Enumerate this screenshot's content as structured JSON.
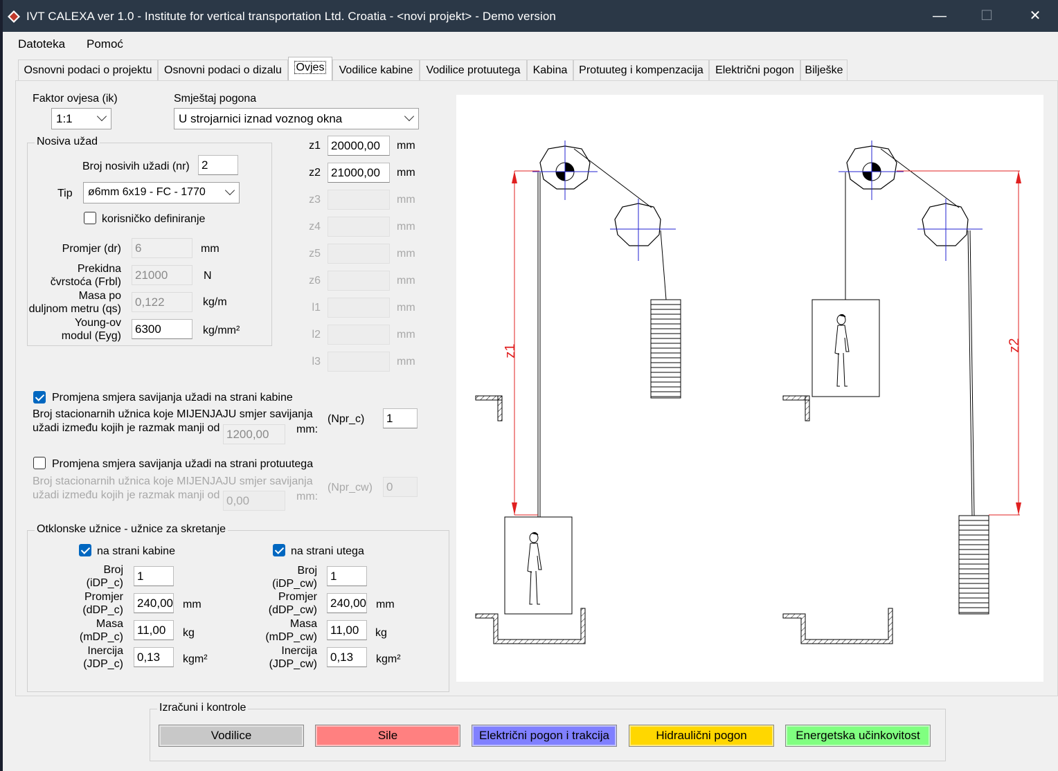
{
  "window": {
    "title": "IVT CALEXA ver 1.0 - Institute for vertical transportation Ltd. Croatia - <novi projekt> - Demo version",
    "minimize": "—",
    "maximize": "☐",
    "close": "✕"
  },
  "menu": {
    "items": [
      "Datoteka",
      "Pomoć"
    ]
  },
  "tabs": [
    "Osnovni podaci o projektu",
    "Osnovni podaci o dizalu",
    "Ovjes",
    "Vodilice kabine",
    "Vodilice protuutega",
    "Kabina",
    "Protuuteg i kompenzacija",
    "Električni pogon",
    "Bilješke"
  ],
  "active_tab": "Ovjes",
  "form": {
    "faktor_label": "Faktor ovjesa (ik)",
    "faktor_value": "1:1",
    "smjestaj_label": "Smještaj pogona",
    "smjestaj_value": "U strojarnici iznad voznog okna",
    "nosiva": {
      "title": "Nosiva užad",
      "broj_label": "Broj nosivih užadi (nr)",
      "broj_value": "2",
      "tip_label": "Tip",
      "tip_value": "ø6mm   6x19 - FC - 1770",
      "korisnicko_label": "korisničko definiranje",
      "promjer_label": "Promjer (dr)",
      "promjer_value": "6",
      "promjer_unit": "mm",
      "prekidna_label1": "Prekidna",
      "prekidna_label2": "čvrstoća (Frbl)",
      "prekidna_value": "21000",
      "prekidna_unit": "N",
      "masa_label1": "Masa po",
      "masa_label2": "duljnom metru (qs)",
      "masa_value": "0,122",
      "masa_unit": "kg/m",
      "young_label1": "Young-ov",
      "young_label2": "modul (Eyg)",
      "young_value": "6300",
      "young_unit": "kg/mm²"
    },
    "z": [
      {
        "label": "z1",
        "value": "20000,00",
        "unit": "mm",
        "enabled": true
      },
      {
        "label": "z2",
        "value": "21000,00",
        "unit": "mm",
        "enabled": true
      },
      {
        "label": "z3",
        "value": "",
        "unit": "mm",
        "enabled": false
      },
      {
        "label": "z4",
        "value": "",
        "unit": "mm",
        "enabled": false
      },
      {
        "label": "z5",
        "value": "",
        "unit": "mm",
        "enabled": false
      },
      {
        "label": "z6",
        "value": "",
        "unit": "mm",
        "enabled": false
      },
      {
        "label": "l1",
        "value": "",
        "unit": "mm",
        "enabled": false
      },
      {
        "label": "l2",
        "value": "",
        "unit": "mm",
        "enabled": false
      },
      {
        "label": "l3",
        "value": "",
        "unit": "mm",
        "enabled": false
      }
    ],
    "kabina_smjer": {
      "checked": true,
      "label": "Promjena smjera savijanja užadi na strani kabine",
      "line1": "Broj stacionarnih užnica koje MIJENJAJU smjer savijanja",
      "line2": "užadi između kojih je razmak manji od",
      "razmak": "1200,00",
      "mm": "mm:",
      "npr_label": "(Npr_c)",
      "npr_value": "1"
    },
    "protu_smjer": {
      "checked": false,
      "label": "Promjena smjera savijanja užadi na strani protuutega",
      "line1": "Broj stacionarnih užnica koje MIJENJAJU smjer savijanja",
      "line2": "užadi između kojih je razmak manji od",
      "razmak": "0,00",
      "mm": "mm:",
      "npr_label": "(Npr_cw)",
      "npr_value": "0"
    },
    "otklonske": {
      "title": "Otklonske užnice - užnice za skretanje",
      "kabina": {
        "check_label": "na strani kabine",
        "broj_l1": "Broj",
        "broj_l2": "(iDP_c)",
        "broj_value": "1",
        "promjer_l1": "Promjer",
        "promjer_l2": "(dDP_c)",
        "promjer_value": "240,00",
        "promjer_unit": "mm",
        "masa_l1": "Masa",
        "masa_l2": "(mDP_c)",
        "masa_value": "11,00",
        "masa_unit": "kg",
        "inercija_l1": "Inercija",
        "inercija_l2": "(JDP_c)",
        "inercija_value": "0,13",
        "inercija_unit": "kgm²"
      },
      "uteg": {
        "check_label": "na strani utega",
        "broj_l1": "Broj",
        "broj_l2": "(iDP_cw)",
        "broj_value": "1",
        "promjer_l1": "Promjer",
        "promjer_l2": "(dDP_cw)",
        "promjer_value": "240,00",
        "promjer_unit": "mm",
        "masa_l1": "Masa",
        "masa_l2": "(mDP_cw)",
        "masa_value": "11,00",
        "masa_unit": "kg",
        "inercija_l1": "Inercija",
        "inercija_l2": "(JDP_cw)",
        "inercija_value": "0,13",
        "inercija_unit": "kgm²"
      }
    }
  },
  "drawing": {
    "z1_label": "z1",
    "z2_label": "z2",
    "dimension_color": "#e02020",
    "axis_color": "#2020d0"
  },
  "izracuni": {
    "title": "Izračuni i kontrole",
    "buttons": [
      {
        "label": "Vodilice",
        "color": "#c8c8c8"
      },
      {
        "label": "Sile",
        "color": "#ff8080"
      },
      {
        "label": "Električni pogon i trakcija",
        "color": "#8080ff"
      },
      {
        "label": "Hidraulični pogon",
        "color": "#ffd700"
      },
      {
        "label": "Energetska učinkovitost",
        "color": "#80ff80"
      }
    ]
  }
}
